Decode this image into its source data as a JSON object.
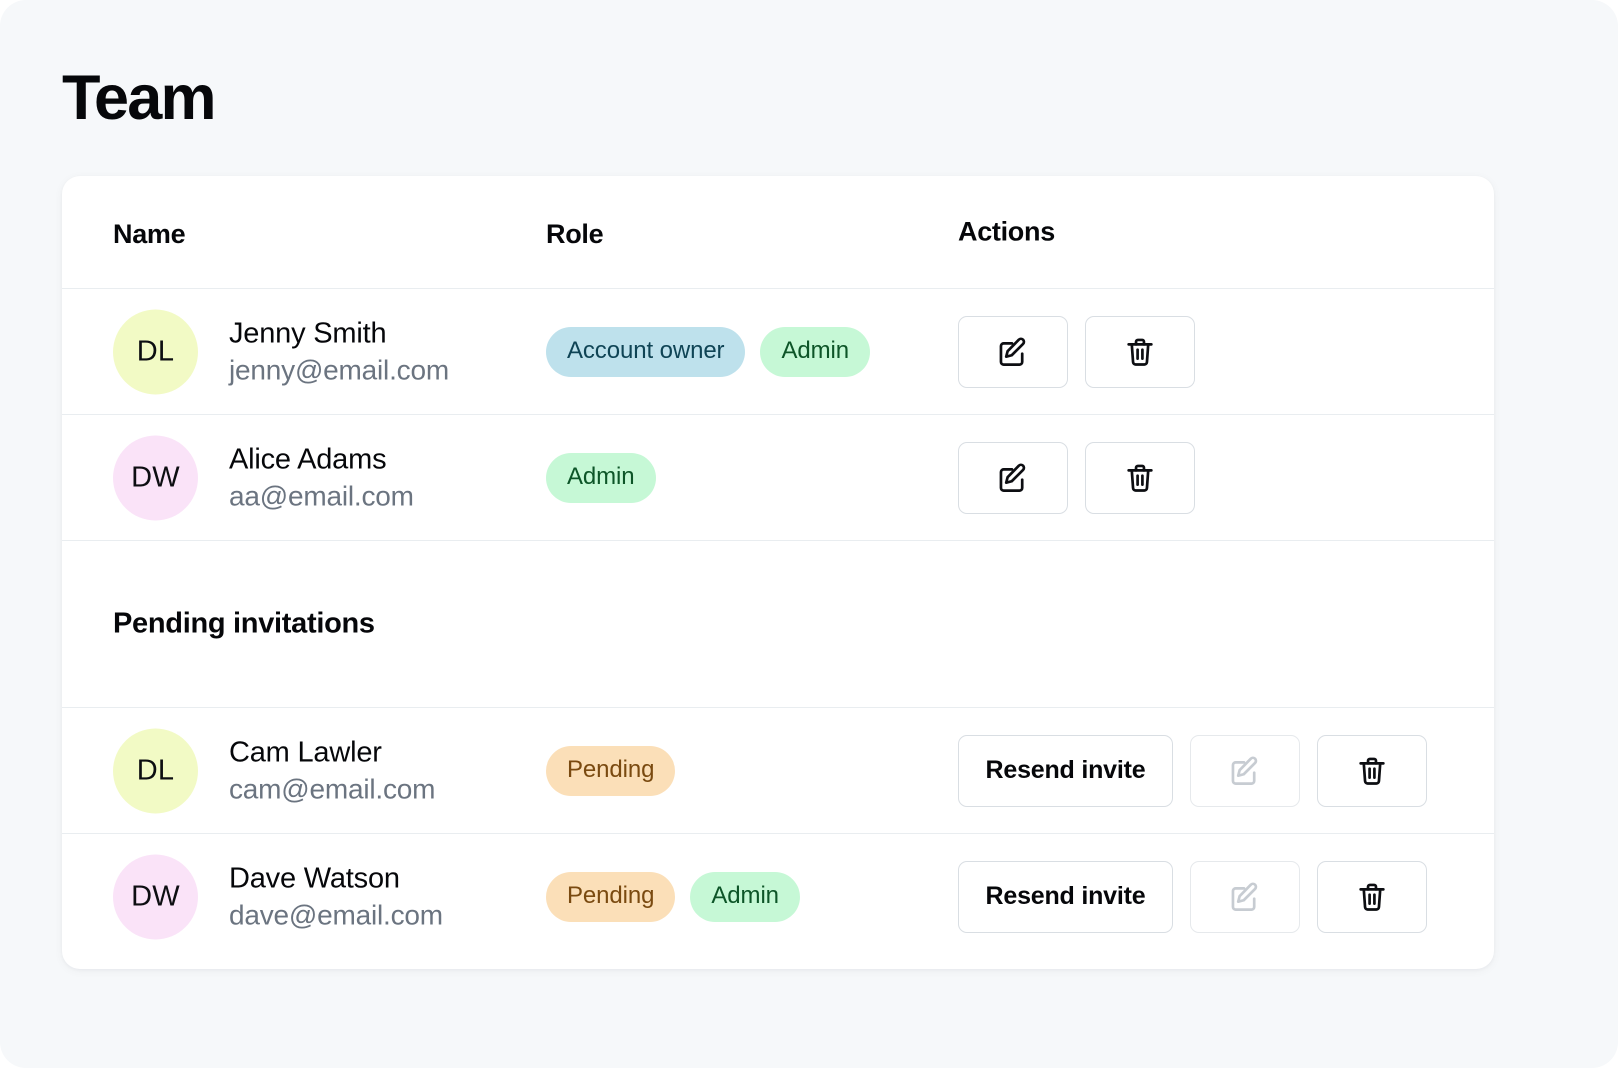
{
  "page": {
    "title": "Team",
    "background_color": "#f6f8fa",
    "card_background": "#ffffff"
  },
  "table": {
    "headers": {
      "name": "Name",
      "role": "Role",
      "actions": "Actions"
    }
  },
  "members": [
    {
      "initials": "DL",
      "avatar_color": "#f2fac5",
      "name": "Jenny Smith",
      "email": "jenny@email.com",
      "badges": [
        {
          "label": "Account owner",
          "type": "owner",
          "bg": "#bee1ec",
          "fg": "#0f4455"
        },
        {
          "label": "Admin",
          "type": "admin",
          "bg": "#c6f8d6",
          "fg": "#0d5528"
        }
      ],
      "actions": [
        {
          "kind": "icon",
          "icon": "edit-icon",
          "disabled": false
        },
        {
          "kind": "icon",
          "icon": "trash-icon",
          "disabled": false
        }
      ]
    },
    {
      "initials": "DW",
      "avatar_color": "#fae3f8",
      "name": "Alice Adams",
      "email": "aa@email.com",
      "badges": [
        {
          "label": "Admin",
          "type": "admin",
          "bg": "#c6f8d6",
          "fg": "#0d5528"
        }
      ],
      "actions": [
        {
          "kind": "icon",
          "icon": "edit-icon",
          "disabled": false
        },
        {
          "kind": "icon",
          "icon": "trash-icon",
          "disabled": false
        }
      ]
    }
  ],
  "pending_section": {
    "title": "Pending invitations",
    "resend_label": "Resend invite"
  },
  "pending": [
    {
      "initials": "DL",
      "avatar_color": "#f2fac5",
      "name": "Cam Lawler",
      "email": "cam@email.com",
      "badges": [
        {
          "label": "Pending",
          "type": "pending",
          "bg": "#fbdfb8",
          "fg": "#7a4a10"
        }
      ],
      "resend_label": "Resend invite",
      "actions": [
        {
          "kind": "text",
          "label": "Resend invite",
          "disabled": false
        },
        {
          "kind": "icon",
          "icon": "edit-icon",
          "disabled": true
        },
        {
          "kind": "icon",
          "icon": "trash-icon",
          "disabled": false
        }
      ]
    },
    {
      "initials": "DW",
      "avatar_color": "#fae3f8",
      "name": "Dave Watson",
      "email": "dave@email.com",
      "badges": [
        {
          "label": "Pending",
          "type": "pending",
          "bg": "#fbdfb8",
          "fg": "#7a4a10"
        },
        {
          "label": "Admin",
          "type": "admin",
          "bg": "#c6f8d6",
          "fg": "#0d5528"
        }
      ],
      "resend_label": "Resend invite",
      "actions": [
        {
          "kind": "text",
          "label": "Resend invite",
          "disabled": false
        },
        {
          "kind": "icon",
          "icon": "edit-icon",
          "disabled": true
        },
        {
          "kind": "icon",
          "icon": "trash-icon",
          "disabled": false
        }
      ]
    }
  ]
}
